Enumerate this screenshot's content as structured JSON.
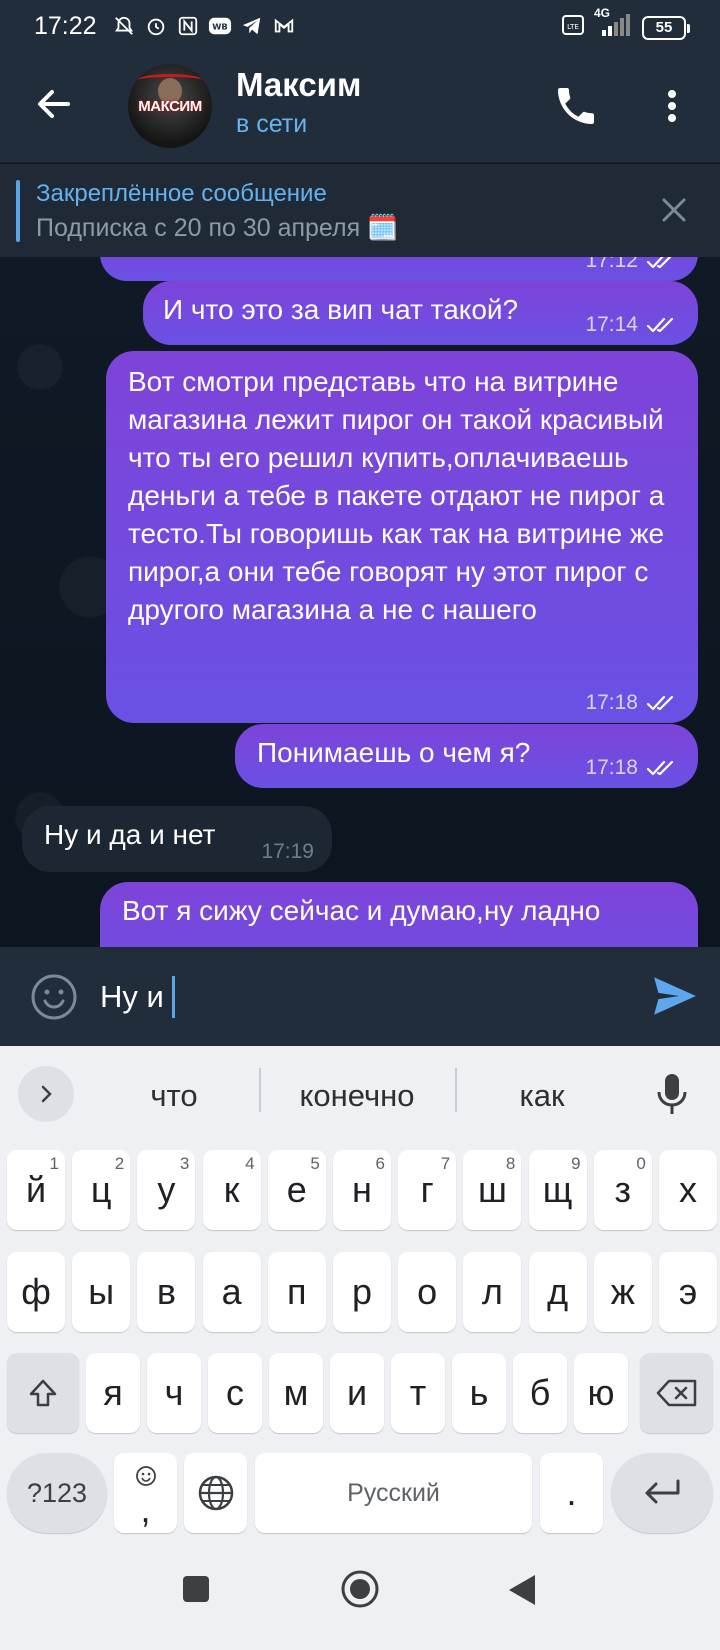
{
  "status_bar": {
    "time": "17:22",
    "battery": "55",
    "network": "4G"
  },
  "header": {
    "name": "Максим",
    "status": "в сети",
    "avatar_text": "МАКСИМ"
  },
  "pinned": {
    "title": "Закреплённое сообщение",
    "text": "Подписка с 20 по 30 апреля 🗓️"
  },
  "messages": [
    {
      "dir": "out",
      "text": "",
      "time": "17:12",
      "read": true
    },
    {
      "dir": "out",
      "text": "И что это за вип чат такой?",
      "time": "17:14",
      "read": true
    },
    {
      "dir": "out",
      "text": "Вот смотри представь что на витрине магазина лежит пирог он такой красивый что ты его решил купить,оплачиваешь деньги а тебе в пакете отдают не пирог а тесто.Ты говоришь как так на витрине же пирог,а они тебе говорят ну этот пирог с другого магазина а не с нашего",
      "time": "17:18",
      "read": true
    },
    {
      "dir": "out",
      "text": "Понимаешь о чем я?",
      "time": "17:18",
      "read": true
    },
    {
      "dir": "in",
      "text": "Ну и да и нет",
      "time": "17:19"
    },
    {
      "dir": "out",
      "text": "Вот я сижу сейчас и думаю,ну ладно",
      "time": ""
    }
  ],
  "input": {
    "value": "Ну и"
  },
  "keyboard": {
    "suggestions": [
      "что",
      "конечно",
      "как"
    ],
    "row1": [
      {
        "k": "й",
        "n": "1"
      },
      {
        "k": "ц",
        "n": "2"
      },
      {
        "k": "у",
        "n": "3"
      },
      {
        "k": "к",
        "n": "4"
      },
      {
        "k": "е",
        "n": "5"
      },
      {
        "k": "н",
        "n": "6"
      },
      {
        "k": "г",
        "n": "7"
      },
      {
        "k": "ш",
        "n": "8"
      },
      {
        "k": "щ",
        "n": "9"
      },
      {
        "k": "з",
        "n": "0"
      },
      {
        "k": "х",
        "n": ""
      }
    ],
    "row2": [
      "ф",
      "ы",
      "в",
      "а",
      "п",
      "р",
      "о",
      "л",
      "д",
      "ж",
      "э"
    ],
    "row3": [
      "я",
      "ч",
      "с",
      "м",
      "и",
      "т",
      "ь",
      "б",
      "ю"
    ],
    "symbols_label": "?123",
    "comma_label": ",",
    "space_label": "Русский",
    "period_label": "."
  }
}
